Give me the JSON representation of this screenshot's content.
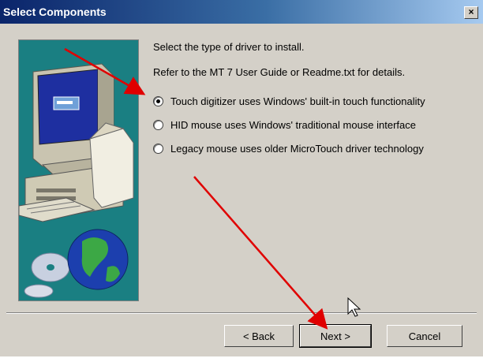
{
  "window": {
    "title": "Select Components",
    "close_label": "×"
  },
  "content": {
    "instruction": "Select the type of driver to install.",
    "refer": "Refer to the MT 7 User Guide or Readme.txt for details.",
    "options": [
      {
        "label": "Touch digitizer uses Windows' built-in touch functionality",
        "selected": true
      },
      {
        "label": "HID mouse uses Windows' traditional mouse interface",
        "selected": false
      },
      {
        "label": "Legacy mouse uses older MicroTouch driver technology",
        "selected": false
      }
    ]
  },
  "buttons": {
    "back": "< Back",
    "next": "Next >",
    "cancel": "Cancel"
  },
  "colors": {
    "titlebar_start": "#0a246a",
    "titlebar_end": "#a6caf0",
    "dialog_bg": "#d4d0c8",
    "sidebar_bg": "#1a7f82",
    "annotation_arrow": "#e00000"
  }
}
